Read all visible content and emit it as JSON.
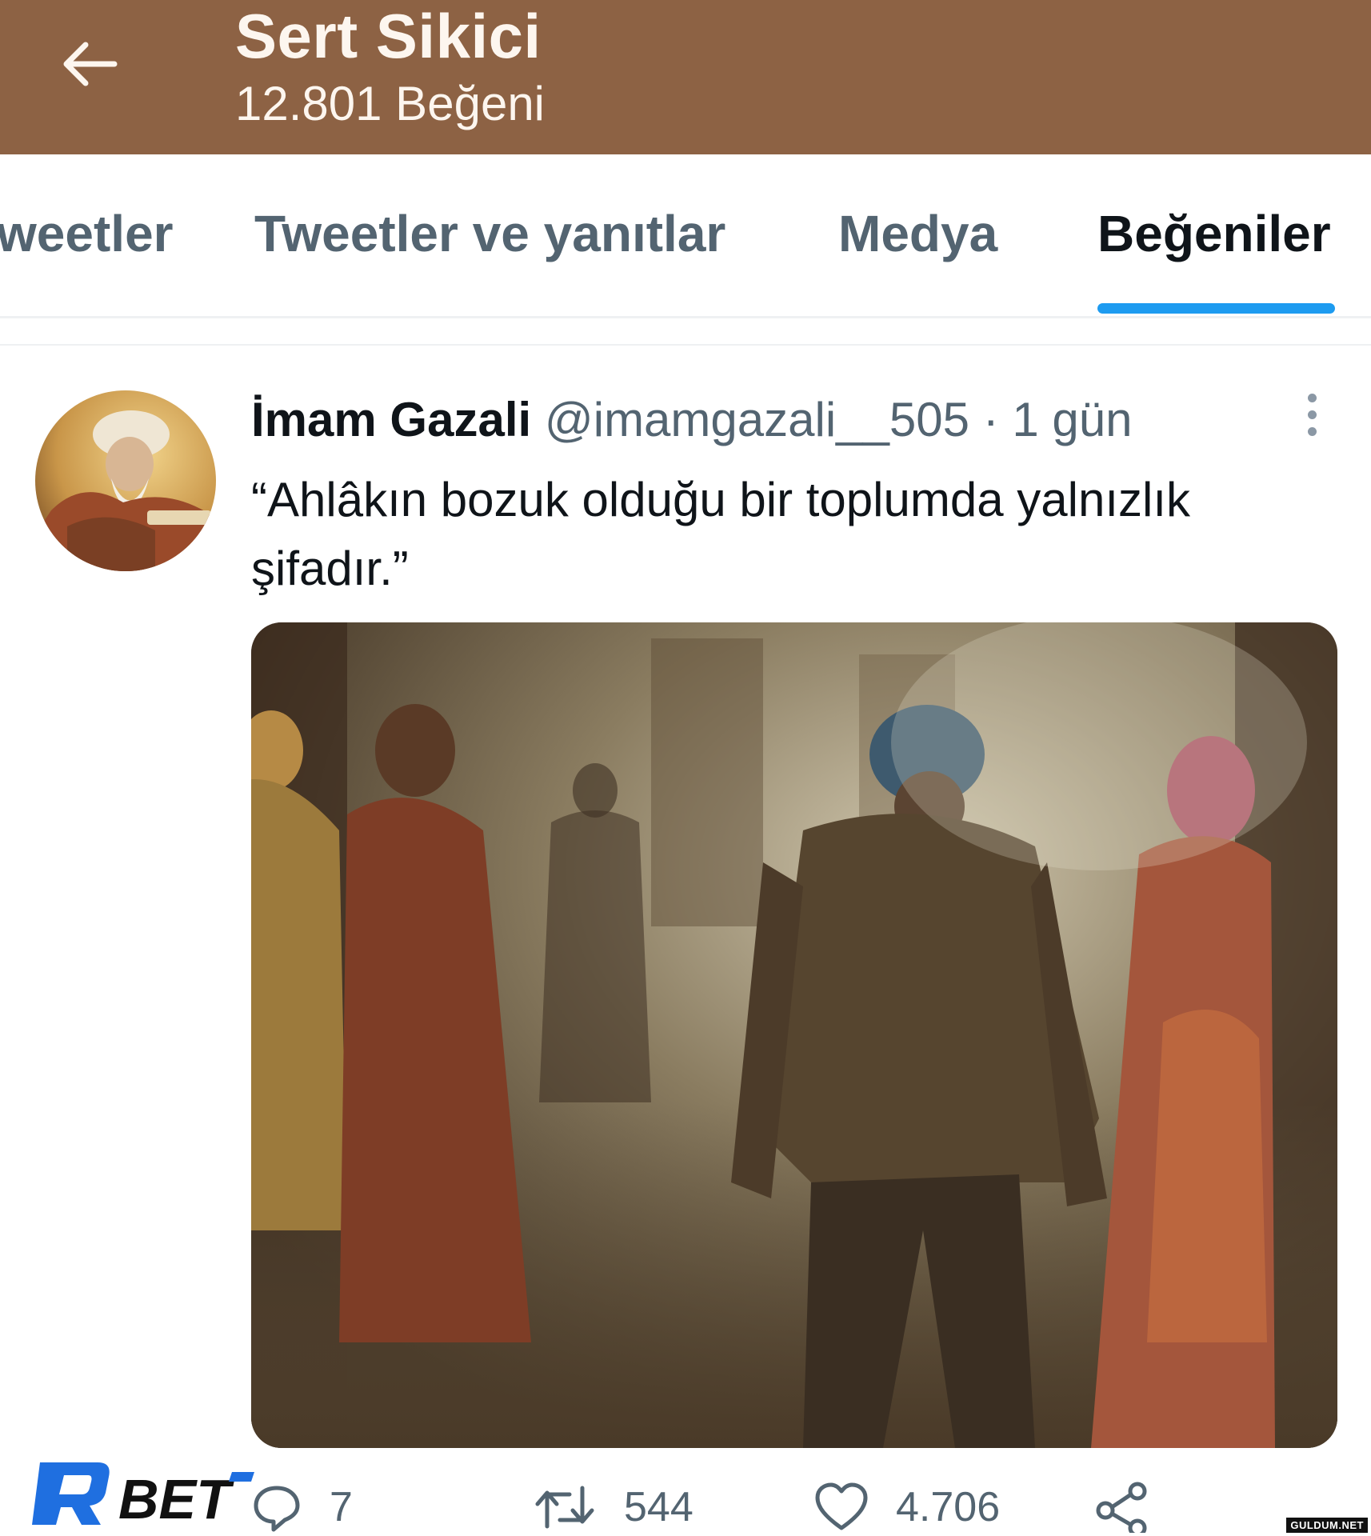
{
  "header": {
    "title": "Sert Sikici",
    "subtitle": "12.801 Beğeni",
    "background_color": "#8d6244"
  },
  "tabs": [
    {
      "label": "weetler",
      "active": false
    },
    {
      "label": "Tweetler ve yanıtlar",
      "active": false
    },
    {
      "label": "Medya",
      "active": false
    },
    {
      "label": "Beğeniler",
      "active": true
    }
  ],
  "tweet": {
    "author_name": "İmam Gazali",
    "author_handle": "@imamgazali__505",
    "separator": "·",
    "time": "1 gün",
    "text": "“Ahlâkın bozuk olduğu bir toplumda yalnızlık şifadır.”",
    "actions": {
      "replies": "7",
      "retweets": "544",
      "likes": "4.706"
    }
  },
  "overlay": {
    "brand_logo": "RBET",
    "watermark": "GULDUM.NET"
  },
  "colors": {
    "accent": "#1d9bf0",
    "secondary_text": "#536471",
    "brand_blue": "#1f6fe0"
  }
}
